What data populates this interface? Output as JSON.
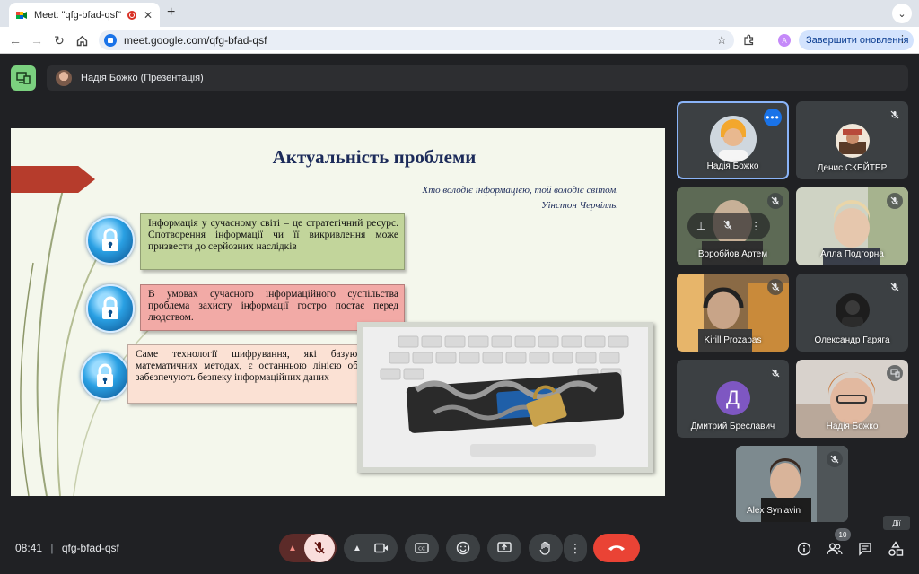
{
  "browser": {
    "tab_title": "Meet: \"qfg-bfad-qsf\"",
    "new_tab_symbol": "+",
    "url": "meet.google.com/qfg-bfad-qsf",
    "profile_initial": "A",
    "update_label": "Завершити оновлення"
  },
  "meet": {
    "presenter_label": "Надія Божко (Презентація)",
    "time": "08:41",
    "meeting_code": "qfg-bfad-qsf",
    "participant_count": "10",
    "activities_tooltip": "Дії"
  },
  "slide": {
    "title": "Актуальність проблеми",
    "quote": "Хто володіє інформацією, той володіє  світом.",
    "quote_author": "Уінстон Черчілль.",
    "bullets": [
      "Інформація у сучасному світі – це стратегічний ресурс. Спотворення інформації чи її викривлення може призвести до серйозних наслідків",
      "В умовах сучасного інформаційного суспільства проблема захисту інформації гостро постає перед людством.",
      "Саме технології шифрування, які базуються на математичних методах,  є останньою лінією оборони та забезпечують безпеку інформаційних даних"
    ]
  },
  "participants": [
    {
      "name": "Надія Божко",
      "muted": false,
      "active": true
    },
    {
      "name": "Денис СКЕЙТЕР",
      "muted": true
    },
    {
      "name": "Воробйов Артем",
      "muted": true
    },
    {
      "name": "Алла Подгорна",
      "muted": true
    },
    {
      "name": "Kirill Prozapas",
      "muted": true
    },
    {
      "name": "Олександр Гаряга",
      "muted": true
    },
    {
      "name": "Дмитрий Бреславич",
      "muted": true,
      "initial": "Д"
    },
    {
      "name": "Надія Божко",
      "muted": false
    },
    {
      "name": "Alex Syniavin",
      "muted": true
    }
  ],
  "colors": {
    "meet_bg": "#202124",
    "tile_bg": "#3c4043",
    "end_call": "#ea4335",
    "mic_off_bg": "#f9dedc",
    "active_border": "#8ab4f8",
    "update_btn": "#d3e3fd",
    "presenting_badge": "#7bd07f"
  }
}
